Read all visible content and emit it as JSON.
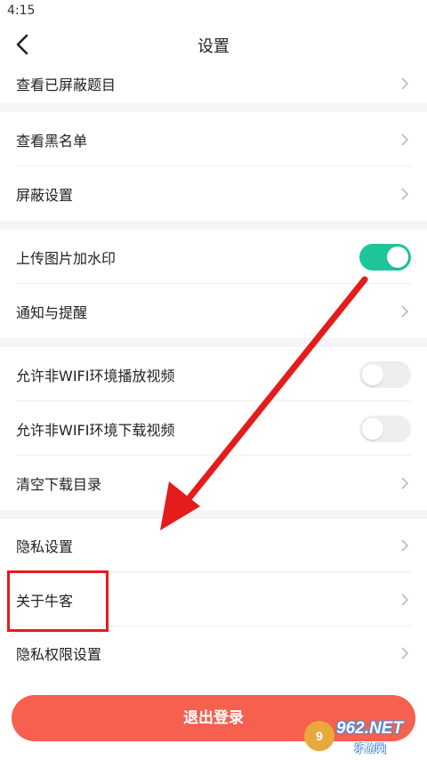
{
  "status_bar": {
    "time": "4:15"
  },
  "nav": {
    "title": "设置"
  },
  "rows": [
    {
      "label": "查看已屏蔽题目"
    },
    {
      "label": "查看黑名单"
    },
    {
      "label": "屏蔽设置"
    },
    {
      "label": "上传图片加水印",
      "toggle": "on"
    },
    {
      "label": "通知与提醒"
    },
    {
      "label": "允许非WIFI环境播放视频",
      "toggle": "off"
    },
    {
      "label": "允许非WIFI环境下载视频",
      "toggle": "off"
    },
    {
      "label": "清空下载目录"
    },
    {
      "label": "隐私设置"
    },
    {
      "label": "关于牛客"
    },
    {
      "label": "隐私权限设置"
    }
  ],
  "logout": {
    "label": "退出登录"
  },
  "watermark": {
    "number": "962",
    "net": ".NET",
    "site": "乐游网"
  },
  "colors": {
    "accent_toggle": "#1ec59a",
    "logout_button": "#f5604f",
    "annotation_red": "#e51c1c",
    "section_gap": "#f5f5f7"
  }
}
